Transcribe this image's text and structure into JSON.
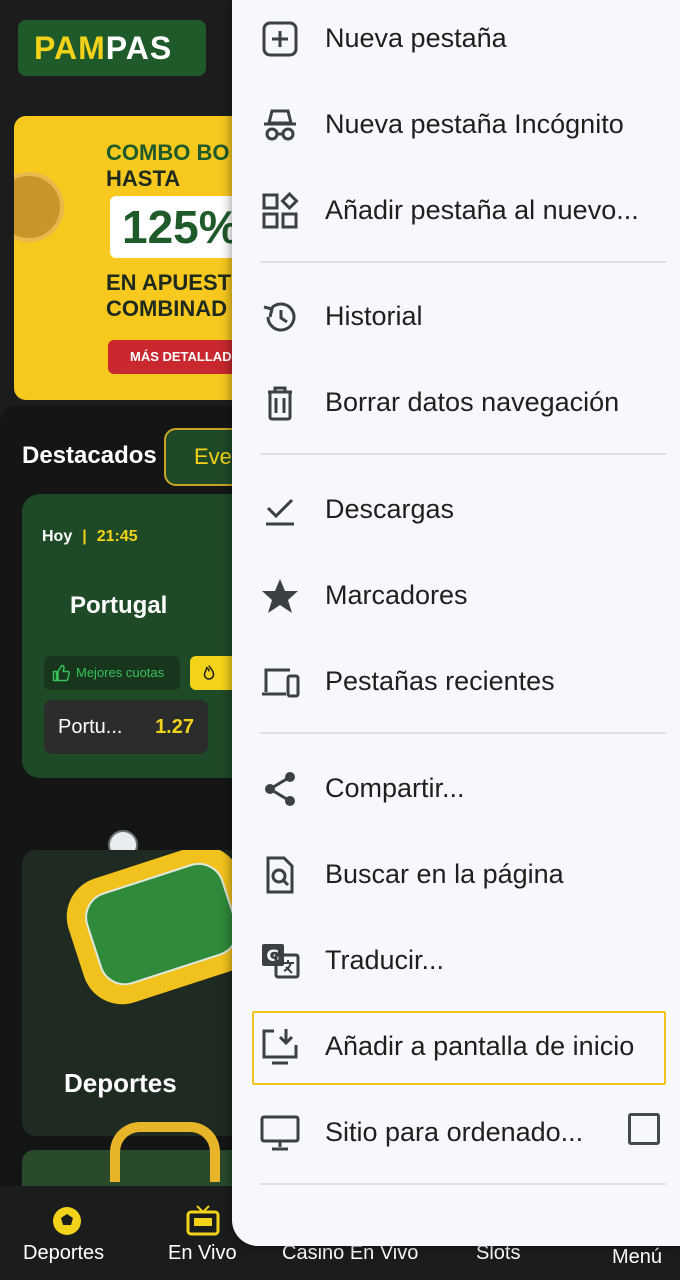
{
  "site": {
    "logo_part1": "PAM",
    "logo_part2": "PAS",
    "banner": {
      "line1": "COMBO BO",
      "line2": "HASTA",
      "percent": "125%",
      "line3": "EN APUEST",
      "line4": "COMBINAD",
      "button": "MÁS DETALLAD"
    },
    "section_title": "Destacados",
    "events_tab": "Even",
    "match": {
      "day": "Hoy",
      "separator": "|",
      "time": "21:45",
      "team": "Portugal",
      "badge": "Mejores cuotas",
      "odd_label": "Portu...",
      "odd_value": "1.27"
    },
    "sports_card_label": "Deportes"
  },
  "bottom_nav": {
    "items": [
      {
        "label": "Deportes",
        "icon": "soccer-ball-icon"
      },
      {
        "label": "En Vivo",
        "icon": "live-tv-icon"
      },
      {
        "label": "Casino En Vivo",
        "icon": "casino-icon"
      },
      {
        "label": "Slots",
        "icon": "slots-icon"
      }
    ],
    "menu_label": "Menú"
  },
  "menu": {
    "items": [
      {
        "label": "Nueva pestaña",
        "icon": "new-tab-icon"
      },
      {
        "label": "Nueva pestaña Incógnito",
        "icon": "incognito-icon"
      },
      {
        "label": "Añadir pestaña al nuevo...",
        "icon": "add-to-group-icon"
      },
      {
        "label": "Historial",
        "icon": "history-icon"
      },
      {
        "label": "Borrar datos navegación",
        "icon": "trash-icon"
      },
      {
        "label": "Descargas",
        "icon": "downloads-icon"
      },
      {
        "label": "Marcadores",
        "icon": "star-icon"
      },
      {
        "label": "Pestañas recientes",
        "icon": "devices-icon"
      },
      {
        "label": "Compartir...",
        "icon": "share-icon"
      },
      {
        "label": "Buscar en la página",
        "icon": "find-in-page-icon"
      },
      {
        "label": "Traducir...",
        "icon": "translate-icon"
      },
      {
        "label": "Añadir a pantalla de inicio",
        "icon": "add-to-home-screen-icon"
      },
      {
        "label": "Sitio para ordenado...",
        "icon": "desktop-icon"
      }
    ],
    "highlighted_item": "Añadir a pantalla de inicio",
    "desktop_site_checked": false
  },
  "colors": {
    "brand_green": "#1f5a2a",
    "brand_yellow": "#f3d21a",
    "menu_background": "#f6f8fc",
    "highlight_border": "#f0c419"
  }
}
